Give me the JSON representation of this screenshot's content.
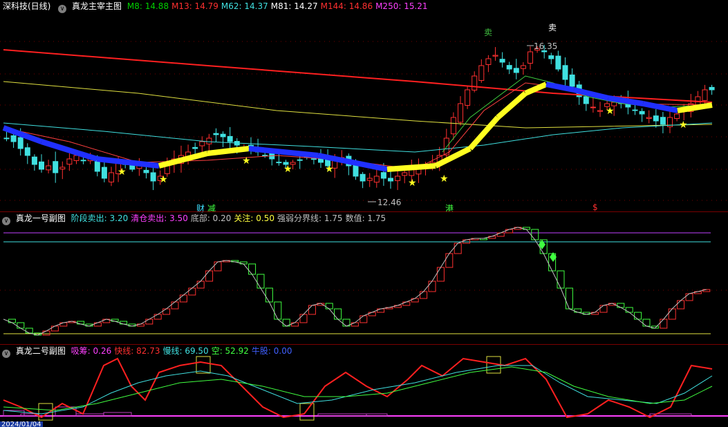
{
  "main": {
    "stock": "深科技(日线)",
    "title": "真龙主宰主图",
    "ma": [
      {
        "label": "M8: 14.88",
        "color": "#00d000"
      },
      {
        "label": "M13: 14.79",
        "color": "#ff3030"
      },
      {
        "label": "M62: 14.37",
        "color": "#40e0e0"
      },
      {
        "label": "M81: 14.27",
        "color": "#ffffff"
      },
      {
        "label": "M144: 14.86",
        "color": "#ff3030"
      },
      {
        "label": "M250: 15.21",
        "color": "#ff40ff"
      }
    ],
    "annotations": {
      "sell1": "卖",
      "sell2": "卖",
      "high": "16.35",
      "low": "12.46",
      "cai": "财",
      "jian": "减",
      "gang": "港",
      "dollar": "$"
    }
  },
  "sub1": {
    "title": "真龙一号副图",
    "items": [
      {
        "label": "阶段卖出: 3.20",
        "color": "#40e0e0"
      },
      {
        "label": "清仓卖出: 3.50",
        "color": "#ff40ff"
      },
      {
        "label": "底部: 0.20",
        "color": "#c0c0c0"
      },
      {
        "label": "关注: 0.50",
        "color": "#ffff40"
      },
      {
        "label": "强弱分界线: 1.75",
        "color": "#c0c0c0"
      },
      {
        "label": "数值: 1.75",
        "color": "#c0c0c0"
      }
    ]
  },
  "sub2": {
    "title": "真龙二号副图",
    "items": [
      {
        "label": "吸筹: 0.26",
        "color": "#ff40ff"
      },
      {
        "label": "快线: 82.73",
        "color": "#ff3030"
      },
      {
        "label": "慢线: 69.50",
        "color": "#40e0e0"
      },
      {
        "label": "空: 52.92",
        "color": "#40ff40"
      },
      {
        "label": "牛股: 0.00",
        "color": "#4060ff"
      }
    ],
    "date": "2024/01/04"
  }
}
